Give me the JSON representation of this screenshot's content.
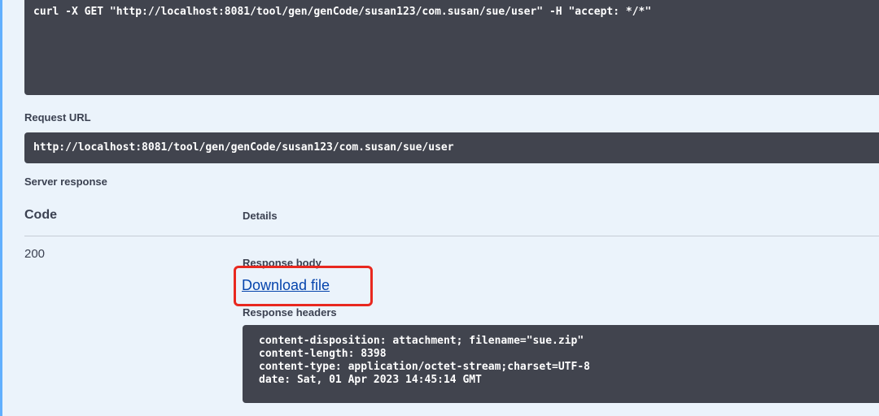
{
  "curl": {
    "command": "curl -X GET \"http://localhost:8081/tool/gen/genCode/susan123/com.susan/sue/user\" -H \"accept: */*\""
  },
  "request_url": {
    "label": "Request URL",
    "value": "http://localhost:8081/tool/gen/genCode/susan123/com.susan/sue/user"
  },
  "server_response": {
    "label": "Server response",
    "columns": {
      "code": "Code",
      "details": "Details"
    },
    "status_code": "200",
    "response_body_label": "Response body",
    "download_link": "Download file",
    "response_headers_label": "Response headers",
    "headers": [
      "content-disposition: attachment; filename=\"sue.zip\"",
      "content-length: 8398",
      "content-type: application/octet-stream;charset=UTF-8",
      "date: Sat, 01 Apr 2023 14:45:14 GMT"
    ]
  },
  "colors": {
    "background": "#ebf3fb",
    "code_block": "#41444e",
    "highlight": "#e8281f",
    "link": "#0645ad",
    "accent": "#61affe"
  }
}
